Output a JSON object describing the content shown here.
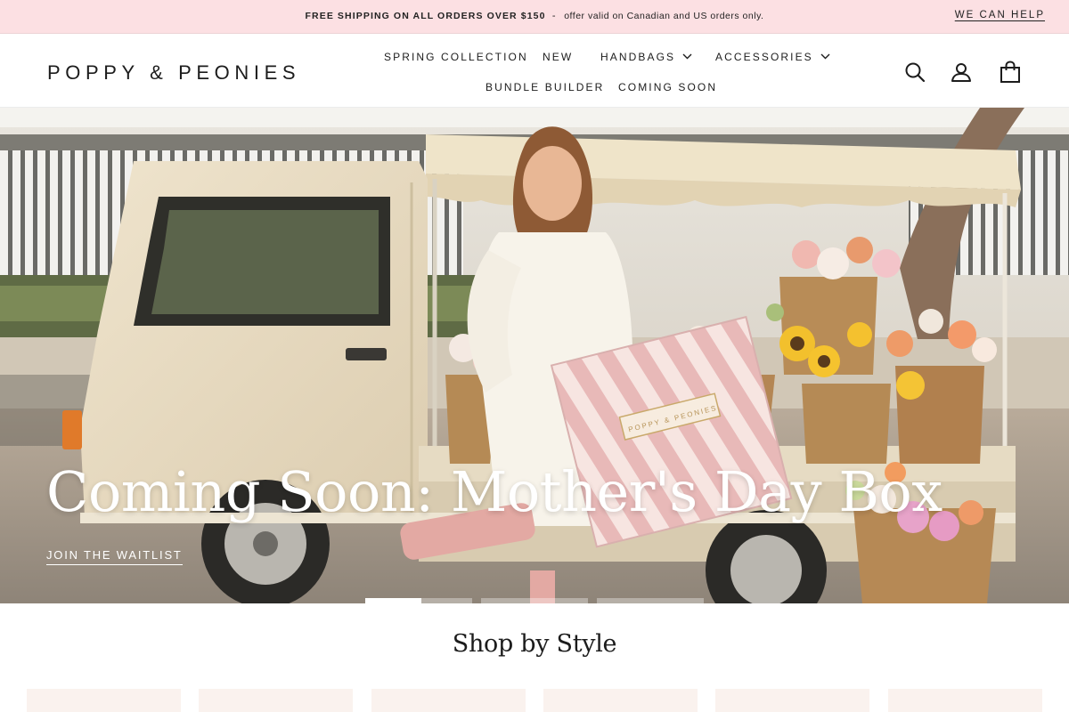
{
  "announcement": {
    "bold": "FREE SHIPPING ON ALL ORDERS OVER $150",
    "separator": "-",
    "rest": "offer valid on Canadian and US orders only.",
    "help_link": "WE CAN HELP"
  },
  "header": {
    "logo": "POPPY & PEONIES",
    "nav": [
      {
        "label": "SPRING COLLECTION"
      },
      {
        "label": "NEW"
      },
      {
        "label": "HANDBAGS"
      },
      {
        "label": "ACCESSORIES"
      },
      {
        "label": "BUNDLE BUILDER"
      },
      {
        "label": "COMING SOON"
      }
    ],
    "icons": [
      "search-icon",
      "account-icon",
      "cart-icon"
    ]
  },
  "hero": {
    "box_label": "POPPY & PEONIES",
    "title": "Coming Soon: Mother's Day Box",
    "cta": "JOIN THE WAITLIST",
    "slides": 4,
    "active_slide": 1
  },
  "shop_by_style": {
    "title": "Shop by Style",
    "tiles": 6
  },
  "colors": {
    "announcement_bg": "#fce0e3",
    "text": "#1c1c1c",
    "tile_bg": "#faf2ee"
  }
}
